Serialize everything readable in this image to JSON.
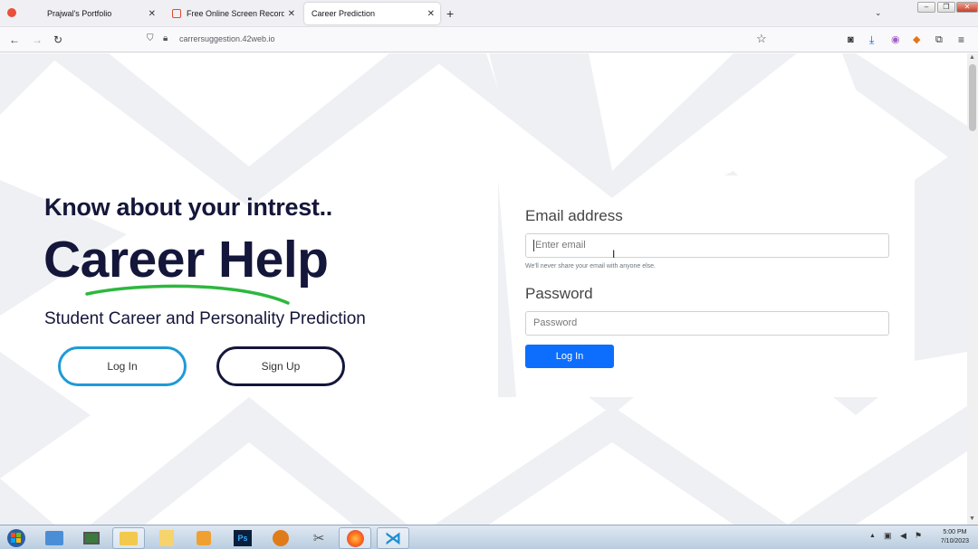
{
  "browser": {
    "tabs": [
      {
        "label": "Prajwal's Portfolio"
      },
      {
        "label": "Free Online Screen Recorder &"
      },
      {
        "label": "Career Prediction"
      }
    ],
    "url": "carrersuggestion.42web.io"
  },
  "hero": {
    "tagline": "Know about your intrest..",
    "title": "Career Help",
    "subtitle": "Student Career and Personality Prediction",
    "login_label": "Log In",
    "signup_label": "Sign Up"
  },
  "form": {
    "email_label": "Email address",
    "email_placeholder": "Enter email",
    "email_help": "We'll never share your email with anyone else.",
    "password_label": "Password",
    "password_placeholder": "Password",
    "submit_label": "Log In"
  },
  "taskbar": {
    "time": "5:00 PM",
    "date": "7/10/2023"
  },
  "colors": {
    "navy": "#14163a",
    "accent_blue": "#1e9bd7",
    "primary": "#0d6efd",
    "swoosh_green": "#2db83d"
  }
}
